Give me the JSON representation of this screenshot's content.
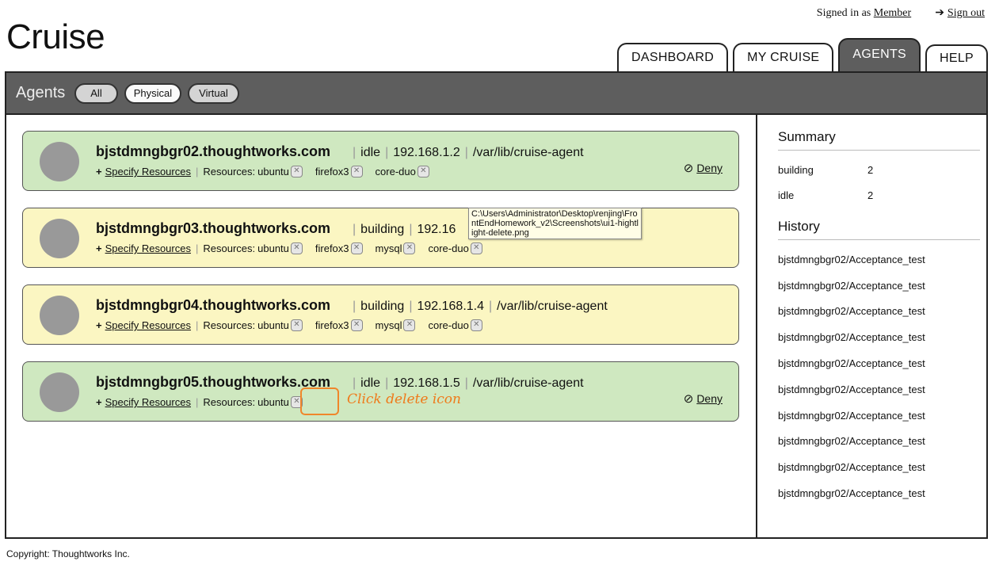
{
  "app": {
    "title": "Cruise"
  },
  "user": {
    "signed_in_prefix": "Signed in as",
    "name": "Member",
    "sign_out": "Sign out"
  },
  "tabs": [
    {
      "label": "DASHBOARD",
      "active": false
    },
    {
      "label": "MY CRUISE",
      "active": false
    },
    {
      "label": "AGENTS",
      "active": true
    },
    {
      "label": "HELP",
      "active": false
    }
  ],
  "filter": {
    "title": "Agents",
    "options": [
      "All",
      "Physical",
      "Virtual"
    ],
    "selected": "Physical"
  },
  "agents": [
    {
      "host": "bjstdmngbgr02.thoughtworks.com",
      "status": "idle",
      "ip": "192.168.1.2",
      "path": "/var/lib/cruise-agent",
      "specify": "Specify Resources",
      "resources_label": "Resources:",
      "resources": [
        "ubuntu",
        "firefox3",
        "core-duo"
      ],
      "deny": "Deny",
      "color": "#cfe8c0"
    },
    {
      "host": "bjstdmngbgr03.thoughtworks.com",
      "status": "building",
      "ip": "192.16",
      "path": "",
      "specify": "Specify Resources",
      "resources_label": "Resources:",
      "resources": [
        "ubuntu",
        "firefox3",
        "mysql",
        "core-duo"
      ],
      "deny": "",
      "color": "#fbf6c2"
    },
    {
      "host": "bjstdmngbgr04.thoughtworks.com",
      "status": "building",
      "ip": "192.168.1.4",
      "path": "/var/lib/cruise-agent",
      "specify": "Specify Resources",
      "resources_label": "Resources:",
      "resources": [
        "ubuntu",
        "firefox3",
        "mysql",
        "core-duo"
      ],
      "deny": "",
      "color": "#fbf6c2"
    },
    {
      "host": "bjstdmngbgr05.thoughtworks.com",
      "status": "idle",
      "ip": "192.168.1.5",
      "path": "/var/lib/cruise-agent",
      "specify": "Specify Resources",
      "resources_label": "Resources:",
      "resources": [
        "ubuntu"
      ],
      "deny": "Deny",
      "color": "#cfe8c0"
    }
  ],
  "tooltip": "C:\\Users\\Administrator\\Desktop\\renjing\\FrontEndHomework_v2\\Screenshots\\ui1-hightlight-delete.png",
  "annotation": {
    "callout": "Click delete icon",
    "color": "#ef7a1a"
  },
  "summary": {
    "title": "Summary",
    "rows": [
      {
        "label": "building",
        "count": "2"
      },
      {
        "label": "idle",
        "count": "2"
      }
    ]
  },
  "history": {
    "title": "History",
    "items": [
      "bjstdmngbgr02/Acceptance_test",
      "bjstdmngbgr02/Acceptance_test",
      "bjstdmngbgr02/Acceptance_test",
      "bjstdmngbgr02/Acceptance_test",
      "bjstdmngbgr02/Acceptance_test",
      "bjstdmngbgr02/Acceptance_test",
      "bjstdmngbgr02/Acceptance_test",
      "bjstdmngbgr02/Acceptance_test",
      "bjstdmngbgr02/Acceptance_test",
      "bjstdmngbgr02/Acceptance_test"
    ]
  },
  "footer": {
    "copyright": "Copyright: Thoughtworks Inc."
  },
  "icons": {
    "delete": "x-box-icon",
    "deny": "circle-slash-icon",
    "sign_out": "arrow-right-icon"
  },
  "colors": {
    "header_bar": "#5e5e5e",
    "idle": "#cfe8c0",
    "building": "#fbf6c2"
  }
}
